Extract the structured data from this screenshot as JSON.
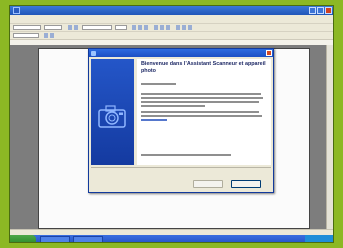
{
  "dialog": {
    "heading": "Bienvenue dans l’Assistant Scanneur et appareil photo"
  },
  "colors": {
    "frame": "#8cb824",
    "dialog_sidebar": "#1f4fc0",
    "titlebar": "#2a62d0"
  },
  "icons": [
    "word-icon",
    "camera-icon",
    "close-icon"
  ]
}
